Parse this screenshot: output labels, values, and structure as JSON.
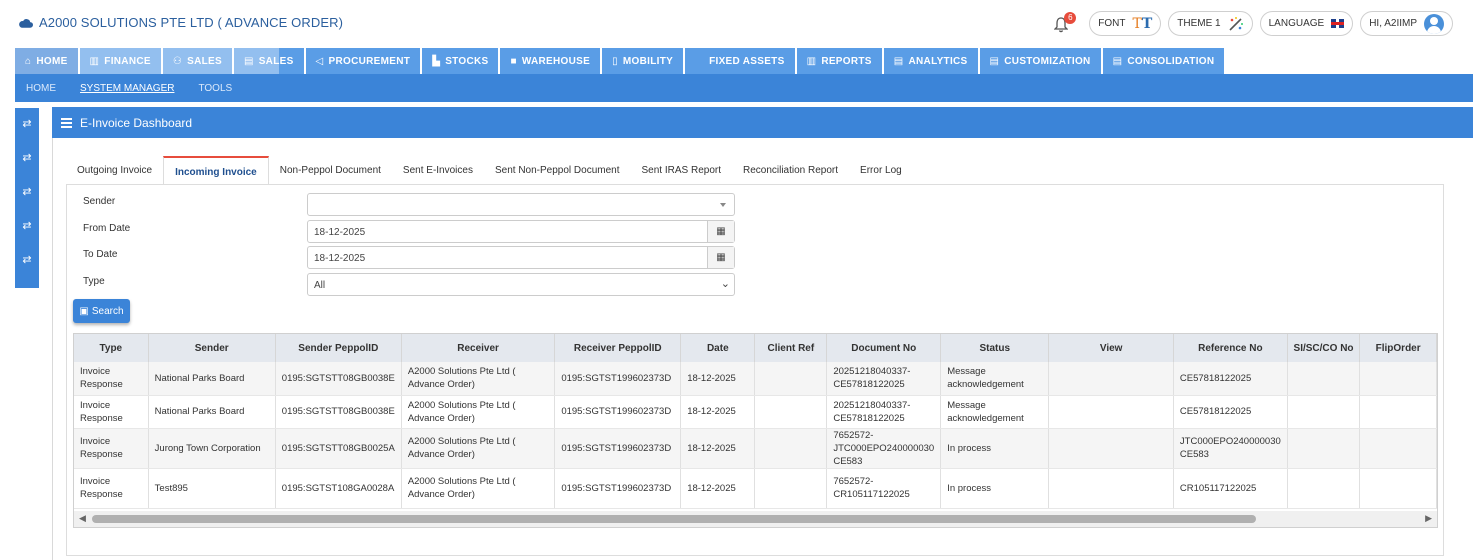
{
  "app": {
    "title": "A2000 SOLUTIONS PTE LTD ( ADVANCE ORDER)",
    "notification_count": "6",
    "font_label": "FONT",
    "theme_label": "THEME 1",
    "language_label": "LANGUAGE",
    "user_label": "HI, A2IIMP"
  },
  "menu": {
    "items": [
      {
        "label": "HOME",
        "icon": "home-icon"
      },
      {
        "label": "FINANCE",
        "icon": "bank-icon"
      },
      {
        "label": "SALES",
        "icon": "users-icon"
      },
      {
        "label": "SALES",
        "icon": "cart-icon"
      },
      {
        "label": "PROCUREMENT",
        "icon": "megaphone-icon"
      },
      {
        "label": "STOCKS",
        "icon": "chart-icon"
      },
      {
        "label": "WAREHOUSE",
        "icon": "warehouse-icon"
      },
      {
        "label": "MOBILITY",
        "icon": "mobile-icon"
      },
      {
        "label": "FIXED ASSETS",
        "icon": ""
      },
      {
        "label": "REPORTS",
        "icon": "report-icon"
      },
      {
        "label": "ANALYTICS",
        "icon": "cart-icon"
      },
      {
        "label": "CUSTOMIZATION",
        "icon": "cart-icon"
      },
      {
        "label": "CONSOLIDATION",
        "icon": "cart-icon"
      }
    ]
  },
  "subnav": {
    "items": [
      "HOME",
      "SYSTEM MANAGER",
      "TOOLS"
    ],
    "active": "SYSTEM MANAGER"
  },
  "panel": {
    "title": "E-Invoice Dashboard"
  },
  "tabs": {
    "items": [
      "Outgoing Invoice",
      "Incoming Invoice",
      "Non-Peppol Document",
      "Sent E-Invoices",
      "Sent Non-Peppol Document",
      "Sent IRAS Report",
      "Reconciliation Report",
      "Error Log"
    ],
    "active": "Incoming Invoice"
  },
  "form": {
    "sender_label": "Sender",
    "sender_value": "",
    "from_date_label": "From Date",
    "from_date_value": "18-12-2025",
    "to_date_label": "To Date",
    "to_date_value": "18-12-2025",
    "type_label": "Type",
    "type_value": "All",
    "search_label": "Search"
  },
  "table": {
    "columns": [
      "Type",
      "Sender",
      "Sender PeppolID",
      "Receiver",
      "Receiver PeppolID",
      "Date",
      "Client Ref",
      "Document No",
      "Status",
      "View",
      "Reference No",
      "SI/SC/CO No",
      "FlipOrder"
    ],
    "rows": [
      [
        "Invoice Response",
        "National Parks Board",
        "0195:SGTSTT08GB0038E",
        "A2000 Solutions Pte Ltd ( Advance Order)",
        "0195:SGTST199602373D",
        "18-12-2025",
        "",
        "20251218040337-CE57818122025",
        "Message acknowledgement",
        "",
        "CE57818122025",
        "",
        ""
      ],
      [
        "Invoice Response",
        "National Parks Board",
        "0195:SGTSTT08GB0038E",
        "A2000 Solutions Pte Ltd ( Advance Order)",
        "0195:SGTST199602373D",
        "18-12-2025",
        "",
        "20251218040337-CE57818122025",
        "Message acknowledgement",
        "",
        "CE57818122025",
        "",
        ""
      ],
      [
        "Invoice Response",
        "Jurong Town Corporation",
        "0195:SGTSTT08GB0025A",
        "A2000 Solutions Pte Ltd ( Advance Order)",
        "0195:SGTST199602373D",
        "18-12-2025",
        "",
        "7652572-JTC000EPO240000030 CE583",
        "In process",
        "",
        "JTC000EPO240000030 CE583",
        "",
        ""
      ],
      [
        "Invoice Response",
        "Test895",
        "0195:SGTST108GA0028A",
        "A2000 Solutions Pte Ltd ( Advance Order)",
        "0195:SGTST199602373D",
        "18-12-2025",
        "",
        "7652572-CR105117122025",
        "In process",
        "",
        "CR105117122025",
        "",
        ""
      ]
    ]
  }
}
